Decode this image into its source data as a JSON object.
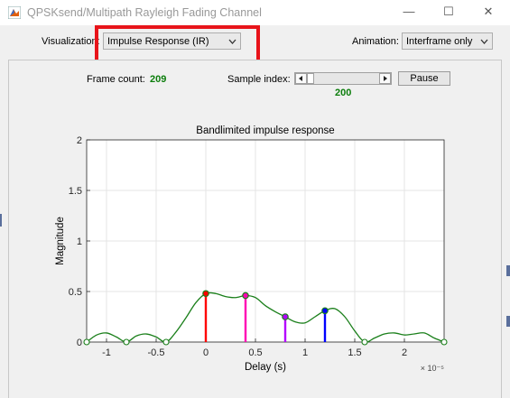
{
  "window": {
    "title": "QPSKsend/Multipath Rayleigh Fading Channel",
    "minimize_glyph": "—",
    "maximize_glyph": "☐",
    "close_glyph": "✕"
  },
  "controls": {
    "visualization_label": "Visualization:",
    "visualization_value": "Impulse Response (IR)",
    "animation_label": "Animation:",
    "animation_value": "Interframe only",
    "frame_count_label": "Frame count:",
    "frame_count_value": "209",
    "sample_index_label": "Sample index:",
    "sample_index_value": "200",
    "pause_label": "Pause"
  },
  "colors": {
    "highlight": "#e8141a",
    "curve": "#1a7f1a",
    "value_text": "#0b7d0b"
  },
  "chart_data": {
    "type": "line",
    "title": "Bandlimited impulse response",
    "xlabel": "Delay (s)",
    "ylabel": "Magnitude",
    "x_exponent": "× 10⁻⁵",
    "xlim": [
      -1.2,
      2.4
    ],
    "ylim": [
      0,
      2
    ],
    "xticks": [
      -1,
      -0.5,
      0,
      0.5,
      1,
      1.5,
      2
    ],
    "yticks": [
      0,
      0.5,
      1,
      1.5,
      2
    ],
    "grid": true,
    "curve": [
      [
        -1.2,
        0
      ],
      [
        -1.1,
        0.07
      ],
      [
        -1.0,
        0.09
      ],
      [
        -0.9,
        0.05
      ],
      [
        -0.8,
        0
      ],
      [
        -0.7,
        0.06
      ],
      [
        -0.6,
        0.08
      ],
      [
        -0.5,
        0.05
      ],
      [
        -0.4,
        0
      ],
      [
        -0.3,
        0.1
      ],
      [
        -0.2,
        0.24
      ],
      [
        -0.1,
        0.39
      ],
      [
        0,
        0.48
      ],
      [
        0.1,
        0.48
      ],
      [
        0.2,
        0.45
      ],
      [
        0.3,
        0.44
      ],
      [
        0.4,
        0.46
      ],
      [
        0.5,
        0.44
      ],
      [
        0.6,
        0.36
      ],
      [
        0.7,
        0.3
      ],
      [
        0.8,
        0.25
      ],
      [
        0.9,
        0.2
      ],
      [
        1.0,
        0.19
      ],
      [
        1.1,
        0.25
      ],
      [
        1.2,
        0.31
      ],
      [
        1.3,
        0.33
      ],
      [
        1.4,
        0.25
      ],
      [
        1.5,
        0.11
      ],
      [
        1.6,
        0
      ],
      [
        1.7,
        0.04
      ],
      [
        1.8,
        0.08
      ],
      [
        1.9,
        0.09
      ],
      [
        2.0,
        0.07
      ],
      [
        2.1,
        0.08
      ],
      [
        2.2,
        0.09
      ],
      [
        2.3,
        0.04
      ],
      [
        2.4,
        0
      ]
    ],
    "paths": [
      {
        "delay": 0,
        "gain": 0.48,
        "color": "#ff0000"
      },
      {
        "delay": 0.4,
        "gain": 0.46,
        "color": "#ff00b4"
      },
      {
        "delay": 0.8,
        "gain": 0.25,
        "color": "#b400ff"
      },
      {
        "delay": 1.2,
        "gain": 0.31,
        "color": "#0000ff"
      }
    ],
    "zero_markers": [
      -1.2,
      -0.8,
      -0.4,
      1.6,
      2.4
    ]
  }
}
